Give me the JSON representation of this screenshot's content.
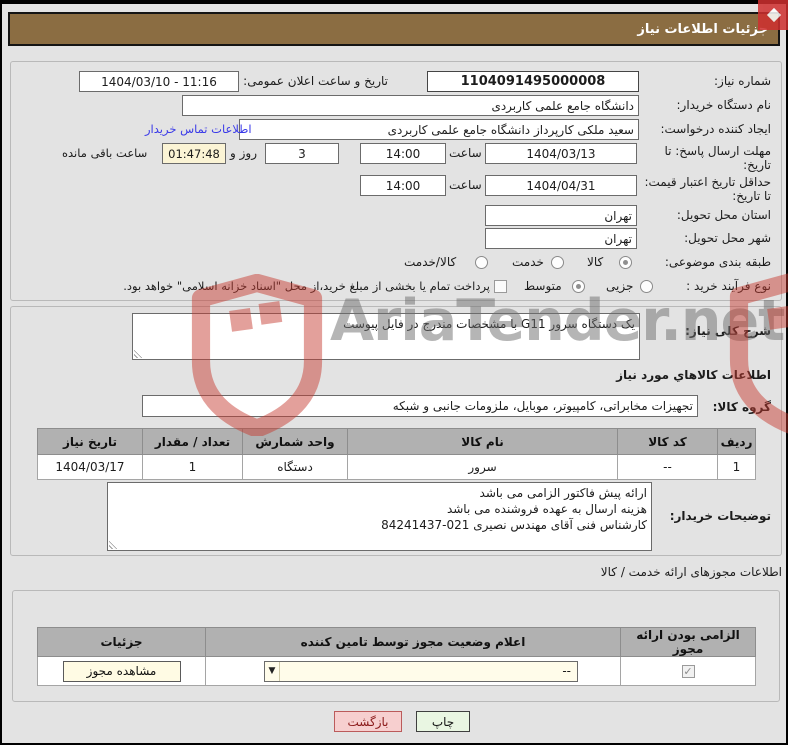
{
  "watermark": {
    "text": "AriaTender.net",
    "red": "#c63a2f",
    "gray": "#6e6e6e"
  },
  "header": {
    "title": "جزئیات اطلاعات نیاز",
    "bg": "#8b6d42"
  },
  "fields": {
    "need_number_label": "شماره نیاز:",
    "need_number_value": "1104091495000008",
    "announce_label": "تاریخ و ساعت اعلان عمومی:",
    "announce_value": "1404/03/10 - 11:16",
    "buyer_org_label": "نام دستگاه خریدار:",
    "buyer_org_value": "دانشگاه جامع علمی کاربردی",
    "creator_label": "ایجاد کننده درخواست:",
    "creator_value": "سعید ملکی کارپرداز دانشگاه جامع علمی کاربردی",
    "buyer_contact_link": "اطلاعات تماس خریدار",
    "deadline_label": "مهلت ارسال پاسخ: تا تاریخ:",
    "deadline_date": "1404/03/13",
    "hour_label": "ساعت",
    "deadline_time": "14:00",
    "days_value": "3",
    "days_suffix": "روز و",
    "countdown_value": "01:47:48",
    "countdown_suffix": "ساعت باقی مانده",
    "validity_label": "حداقل تاریخ اعتبار قیمت: تا تاریخ:",
    "validity_date": "1404/04/31",
    "validity_time": "14:00",
    "province_label": "استان محل تحویل:",
    "province_value": "تهران",
    "city_label": "شهر محل تحویل:",
    "city_value": "تهران",
    "category_label": "طبقه بندی موضوعی:",
    "category_options": [
      {
        "label": "کالا",
        "selected": true
      },
      {
        "label": "خدمت",
        "selected": false
      },
      {
        "label": "کالا/خدمت",
        "selected": false
      }
    ],
    "process_label": "نوع فرآیند خرید :",
    "process_options": [
      {
        "label": "جزیی",
        "selected": false
      },
      {
        "label": "متوسط",
        "selected": true
      }
    ],
    "treasury_checkbox_label": "پرداخت تمام یا بخشی از مبلغ خرید،از محل \"اسناد خزانه اسلامی\" خواهد بود.",
    "treasury_checked": false
  },
  "need_section": {
    "desc_label": "شرح کلی نیاز:",
    "desc_value": "یک دستگاه سرور G11 با مشخصات مندرج در فایل پیوست",
    "goods_heading": "اطلاعات کالاهاي مورد نیاز",
    "group_label": "گروه کالا:",
    "group_value": "تجهیزات مخابراتی، کامپیوتر، موبایل، ملزومات جانبی و شبکه",
    "table": {
      "headers": [
        "ردیف",
        "کد کالا",
        "نام کالا",
        "واحد شمارش",
        "تعداد / مقدار",
        "تاریخ نیاز"
      ],
      "rows": [
        [
          "1",
          "--",
          "سرور",
          "دستگاه",
          "1",
          "1404/03/17"
        ]
      ]
    },
    "buyer_notes_label": "توضیحات خریدار:",
    "buyer_notes_value": "ارائه پیش فاکتور الزامی می باشد\nهزینه ارسال به عهده فروشنده می باشد\nکارشناس فنی آقای مهندس نصیری 021-84241437"
  },
  "permits_section": {
    "heading": "اطلاعات مجوزهای ارائه خدمت / کالا",
    "table_headers": [
      "الزامی بودن ارائه مجوز",
      "اعلام وضعیت مجوز توسط تامین کننده",
      "جزئیات"
    ],
    "required_checked": true,
    "status_value": "--",
    "details_button": "مشاهده مجوز"
  },
  "footer": {
    "print_button": "چاپ",
    "back_button": "بازگشت"
  }
}
